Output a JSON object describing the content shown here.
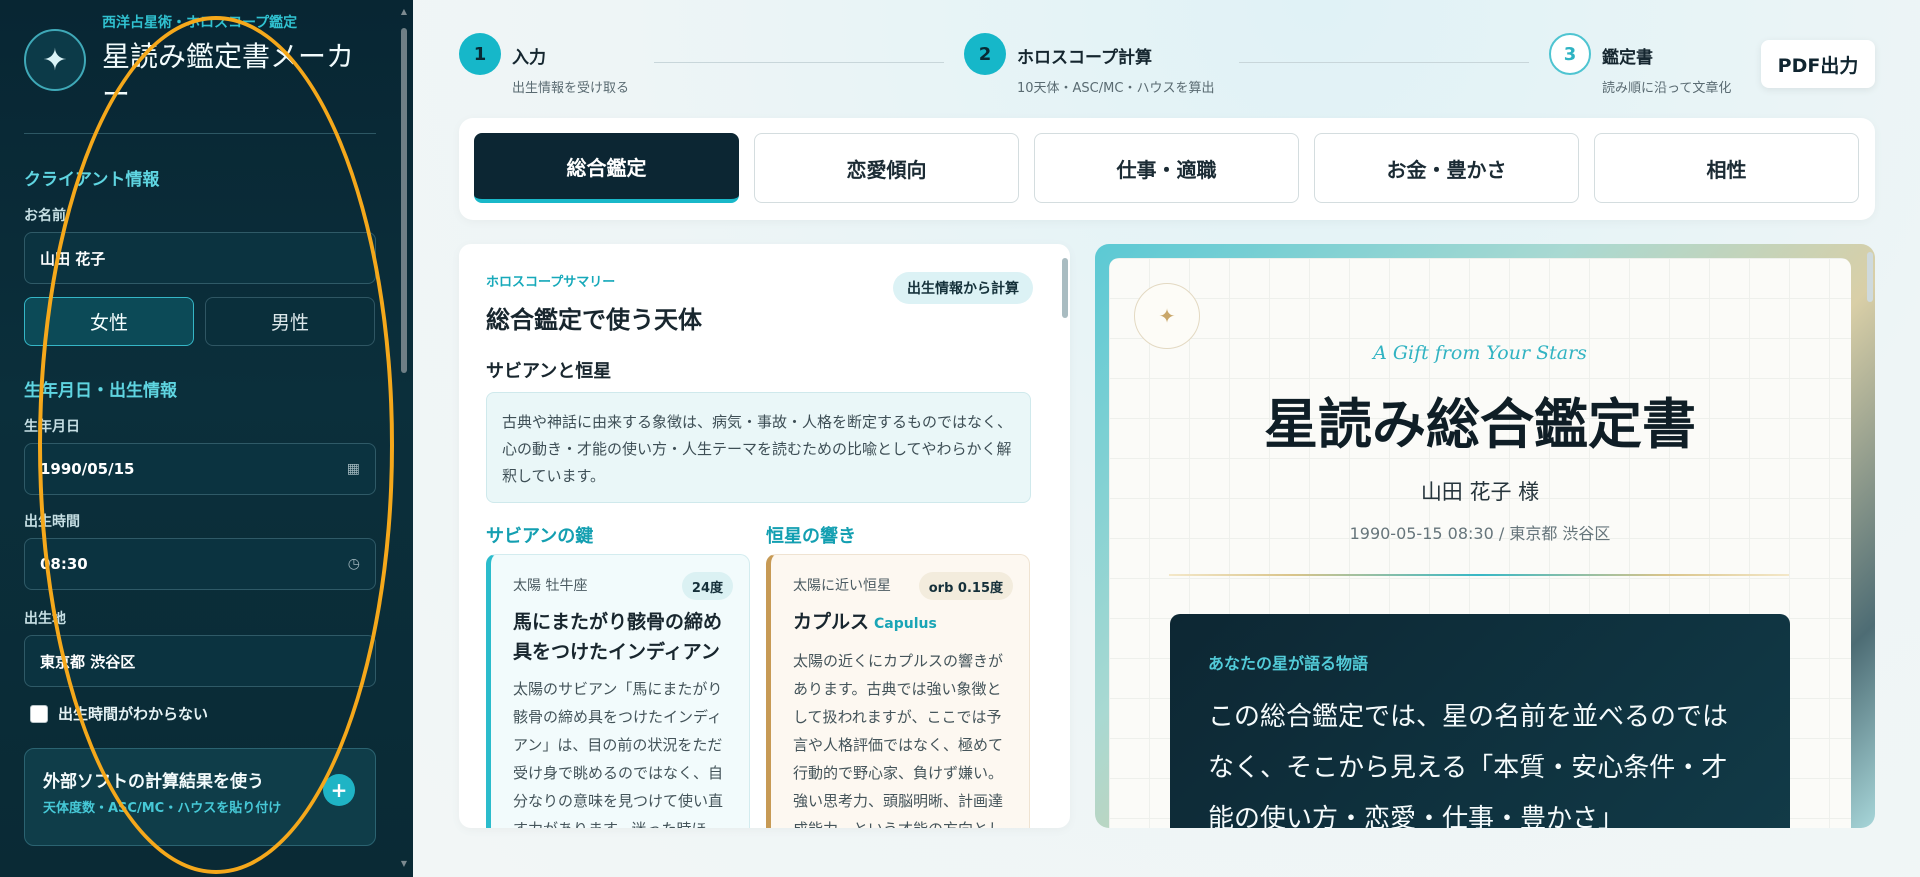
{
  "sidebar": {
    "brand_subtitle": "西洋占星術・ホロスコープ鑑定",
    "brand_title": "星読み鑑定書メーカー",
    "brand_icon": "sparkle-icon",
    "client_section": "クライアント情報",
    "name_label": "お名前",
    "name_value": "山田 花子",
    "gender_female": "女性",
    "gender_male": "男性",
    "gender_selected": "女性",
    "birth_section": "生年月日・出生情報",
    "birthdate_label": "生年月日",
    "birthdate_value": "1990/05/15",
    "birthtime_label": "出生時間",
    "birthtime_value": "08:30",
    "birthplace_label": "出生地",
    "birthplace_value": "東京都 渋谷区",
    "unknown_time_label": "出生時間がわからない",
    "external_title": "外部ソフトの計算結果を使う",
    "external_desc": "天体度数・ASC/MC・ハウスを貼り付け"
  },
  "steps": [
    {
      "num": "1",
      "title": "入力",
      "desc": "出生情報を受け取る"
    },
    {
      "num": "2",
      "title": "ホロスコープ計算",
      "desc": "10天体・ASC/MC・ハウスを算出"
    },
    {
      "num": "3",
      "title": "鑑定書",
      "desc": "読み順に沿って文章化"
    }
  ],
  "pdf_button": "PDF出力",
  "tabs": [
    "総合鑑定",
    "恋愛傾向",
    "仕事・適職",
    "お金・豊かさ",
    "相性"
  ],
  "active_tab": "総合鑑定",
  "summary": {
    "kicker": "ホロスコープサマリー",
    "title": "総合鑑定で使う天体",
    "badge": "出生情報から計算",
    "subheading": "サビアンと恒星",
    "note": "古典や神話に由来する象徴は、病気・事故・人格を断定するものではなく、心の動き・才能の使い方・人生テーマを読むための比喩としてやわらかく解釈しています。",
    "sabian_head": "サビアンの鍵",
    "star_head": "恒星の響き",
    "sabian_card": {
      "kicker": "太陽 牡牛座",
      "badge": "24度",
      "title": "馬にまたがり骸骨の締め具をつけたインディアン",
      "body": "太陽のサビアン「馬にまたがり骸骨の締め具をつけたインディアン」は、目の前の状況をただ受け身で眺めるのではなく、自分なりの意味を見つけて使い直す力があります。迷った時ほど、"
    },
    "star_card": {
      "kicker": "太陽に近い恒星",
      "badge": "orb 0.15度",
      "title": "カプルス",
      "title_en": "Capulus",
      "body": "太陽の近くにカプルスの響きがあります。古典では強い象徴として扱われますが、ここでは予言や人格評価ではなく、極めて行動的で野心家、負けず嫌い。強い思考力、頭脳明晰、計画達成能力、という才能の方向とし"
    }
  },
  "certificate": {
    "kicker": "A Gift from Your Stars",
    "title": "星読み総合鑑定書",
    "recipient": "山田 花子 様",
    "meta": "1990-05-15 08:30 / 東京都 渋谷区",
    "story_kicker": "あなたの星が語る物語",
    "story_text": "この総合鑑定では、星の名前を並べるのではなく、そこから見える「本質・安心条件・才能の使い方・恋愛・仕事・豊かさ」"
  },
  "colors": {
    "accent": "#16b7c9",
    "sidebar_bg": "#082633",
    "annotation": "#f5a81b"
  }
}
